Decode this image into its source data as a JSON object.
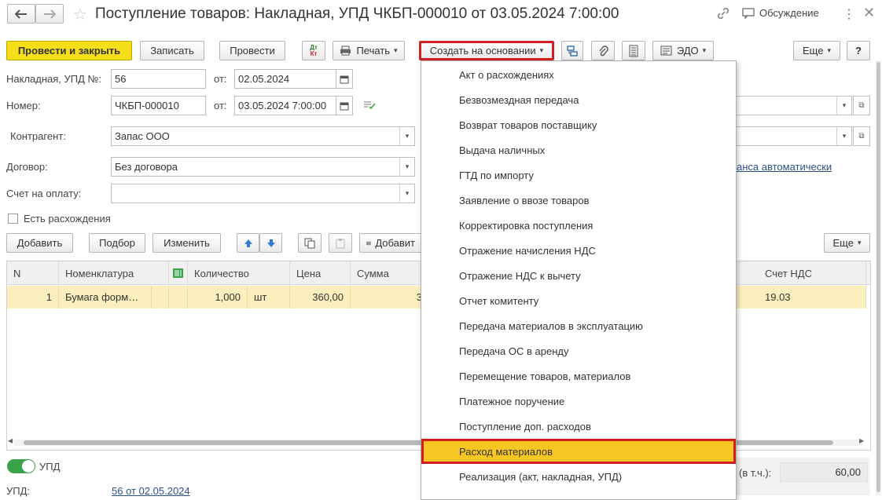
{
  "window": {
    "title": "Поступление товаров: Накладная, УПД ЧКБП-000010 от 03.05.2024 7:00:00",
    "discussion_label": "Обсуждение"
  },
  "toolbar": {
    "post_and_close": "Провести и закрыть",
    "save": "Записать",
    "post": "Провести",
    "dtkt_icon": "Дт Кт",
    "print": "Печать",
    "create_based_on": "Создать на основании",
    "edo": "ЭДО",
    "more": "Еще",
    "help": "?"
  },
  "form": {
    "invoice_label": "Накладная, УПД №:",
    "invoice_number": "56",
    "date_label": "от:",
    "invoice_date": "02.05.2024",
    "number_label": "Номер:",
    "number_value": "ЧКБП-000010",
    "number_date_label": "от:",
    "number_date": "03.05.2024  7:00:00",
    "counterparty_label": "Контрагент:",
    "counterparty_value": "Запас ООО",
    "contract_label": "Договор:",
    "contract_value": "Без договора",
    "advance_link": "анса автоматически",
    "payment_invoice_label": "Счет на оплату:",
    "payment_invoice_value": "",
    "discrepancy_label": "Есть расхождения"
  },
  "table_toolbar": {
    "add": "Добавить",
    "select": "Подбор",
    "change": "Изменить",
    "add2": "Добавит",
    "more": "Еще"
  },
  "table": {
    "headers": {
      "n": "N",
      "nomenclature": "Номенклатура",
      "quantity": "Количество",
      "price": "Цена",
      "sum": "Сумма",
      "vat_account": "Счет НДС"
    },
    "rows": [
      {
        "n": "1",
        "nomenclature": "Бумага форм…",
        "quantity": "1,000",
        "unit": "шт",
        "price": "360,00",
        "sum": "3",
        "vat_account": "19.03"
      }
    ]
  },
  "menu": {
    "items": [
      "Акт о расхождениях",
      "Безвозмездная передача",
      "Возврат товаров поставщику",
      "Выдача наличных",
      "ГТД по импорту",
      "Заявление о ввозе товаров",
      "Корректировка поступления",
      "Отражение начисления НДС",
      "Отражение НДС к вычету",
      "Отчет комитенту",
      "Передача материалов в эксплуатацию",
      "Передача ОС в аренду",
      "Перемещение товаров, материалов",
      "Платежное поручение",
      "Поступление доп. расходов",
      "Расход материалов",
      "Реализация (акт, накладная, УПД)"
    ],
    "highlighted_index": 15
  },
  "footer": {
    "upd_toggle_label": "УПД",
    "upd_label": "УПД:",
    "upd_link": "56 от 02.05.2024",
    "vat_label": "(в т.ч.):",
    "vat_value": "60,00"
  },
  "colors": {
    "primary_button": "#f6df1a",
    "highlight_border": "#d21f1f",
    "menu_highlight": "#f7c623",
    "row_selected": "#fbf0bd",
    "toggle_on": "#3aa34a"
  }
}
